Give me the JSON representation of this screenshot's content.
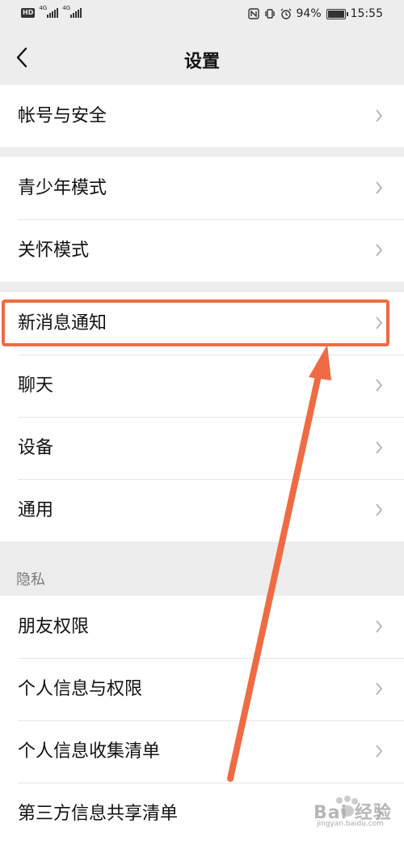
{
  "status_bar": {
    "hd_badge": "HD",
    "sim1_type": "4G",
    "sim2_type": "4G",
    "battery": "94%",
    "battery_level": 0.94,
    "time": "15:55"
  },
  "header": {
    "title": "设置",
    "back_icon": "chevron-left-icon"
  },
  "groups": [
    {
      "items": [
        {
          "label": "帐号与安全"
        }
      ]
    },
    {
      "items": [
        {
          "label": "青少年模式"
        },
        {
          "label": "关怀模式"
        }
      ]
    },
    {
      "items": [
        {
          "label": "新消息通知"
        },
        {
          "label": "聊天"
        },
        {
          "label": "设备"
        },
        {
          "label": "通用"
        }
      ]
    },
    {
      "header": "隐私",
      "items": [
        {
          "label": "朋友权限"
        },
        {
          "label": "个人信息与权限"
        },
        {
          "label": "个人信息收集清单"
        },
        {
          "label": "第三方信息共享清单"
        }
      ]
    }
  ],
  "annotation": {
    "highlighted_item": "新消息通知",
    "color": "#ef6b44"
  },
  "watermark": {
    "text": "Bai 经验",
    "sub": "jingyan.baidu.com"
  },
  "colors": {
    "background": "#ededed",
    "card": "#ffffff",
    "chevron": "#b2b2b2"
  }
}
